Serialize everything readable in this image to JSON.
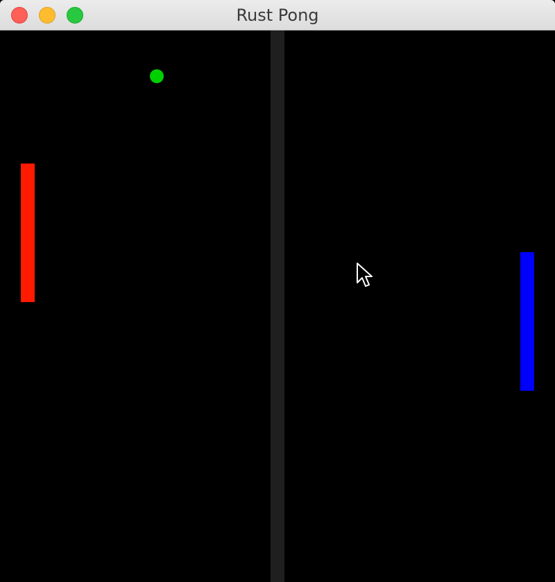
{
  "window": {
    "title": "Rust Pong"
  },
  "traffic_lights": [
    {
      "name": "close",
      "color": "#fe5f57"
    },
    {
      "name": "minimize",
      "color": "#febc2e"
    },
    {
      "name": "maximize",
      "color": "#28c840"
    }
  ],
  "game": {
    "background_color": "#000000",
    "net_color": "#1f1f1f",
    "left_paddle": {
      "color": "#ff1a00"
    },
    "right_paddle": {
      "color": "#0000ff"
    },
    "ball": {
      "color": "#00d000"
    }
  },
  "cursor": {
    "icon": "arrow-pointer-icon"
  }
}
